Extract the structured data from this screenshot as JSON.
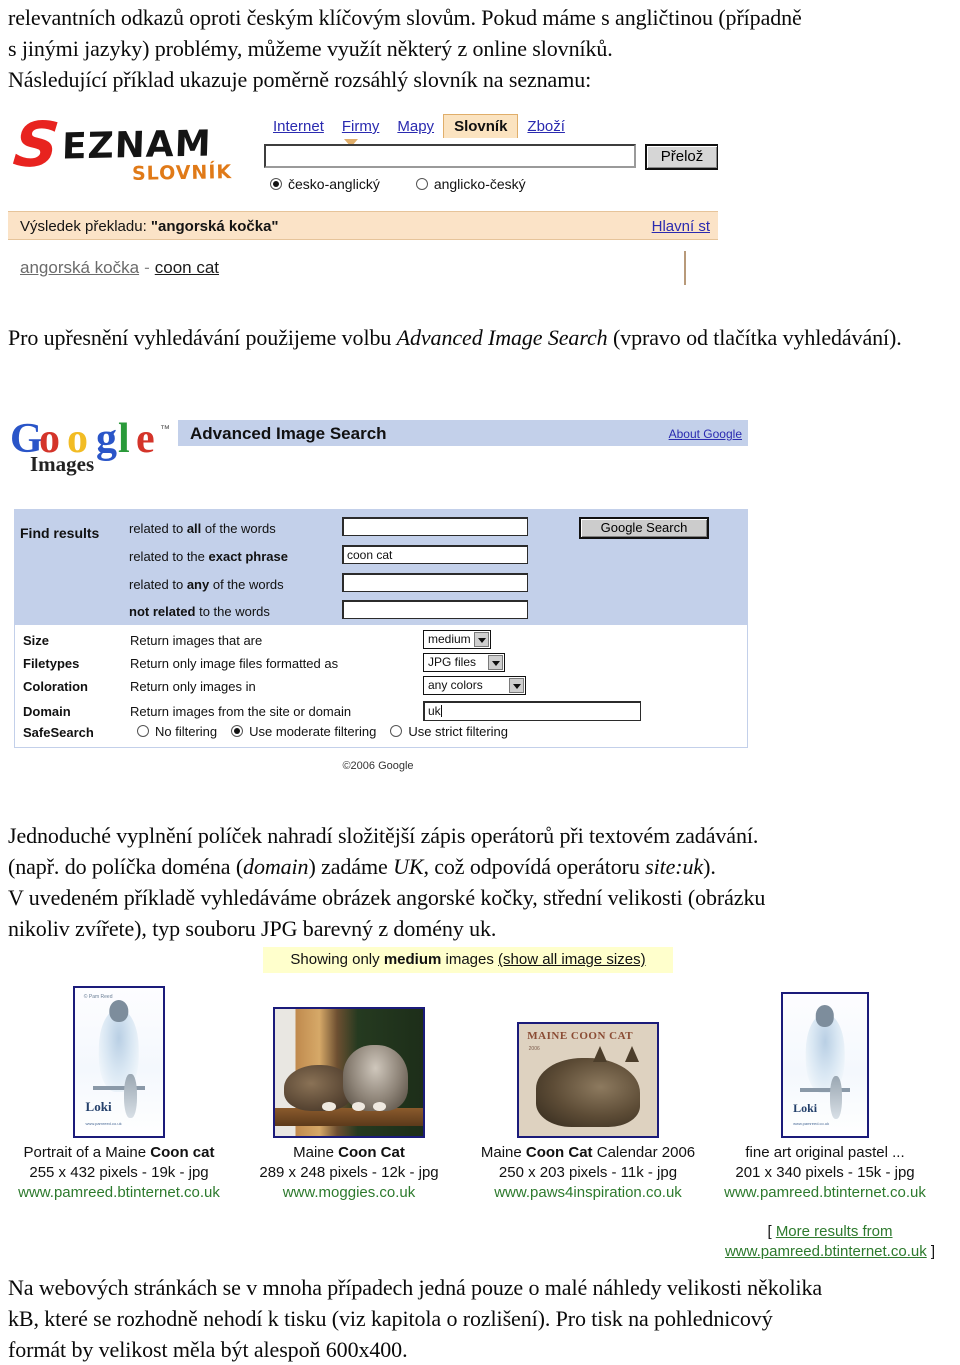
{
  "document": {
    "para_intro": [
      "relevantních odkazů oproti českým klíčovým slovům. Pokud máme s angličtinou (případně",
      "s jinými jazyky) problémy, můžeme využít některý z online slovníků.",
      "Následující příklad ukazuje poměrně rozsáhlý slovník na seznamu:"
    ],
    "para_advanced_prefix": "Pro upřesnění vyhledávání použijeme volbu ",
    "para_advanced_italic": "Advanced Image Search",
    "para_advanced_suffix": " (vpravo od tlačítka vyhledávání).",
    "para_simple": {
      "line1": "Jednoduché vyplnění políček nahradí složitější zápis operátorů při textovém zadávání.",
      "line2_a": "(např. do políčka doména (",
      "line2_i1": "domain",
      "line2_b": ") zadáme ",
      "line2_i2": "UK",
      "line2_c": ", což odpovídá operátoru ",
      "line2_i3": "site:uk",
      "line2_d": ").",
      "line3": "V uvedeném příkladě vyhledáváme obrázek angorské kočky, střední velikosti (obrázku",
      "line4": "nikoliv zvířete), typ souboru JPG barevný z domény uk."
    },
    "para_final": [
      "Na webových stránkách se v mnoha případech jedná pouze o malé náhledy velikosti několika",
      "kB, které se rozhodně nehodí k tisku (viz kapitola o rozlišení). Pro tisk na pohlednicový",
      "formát by velikost měla být alespoň 600x400."
    ]
  },
  "seznam": {
    "logo": {
      "s": "S",
      "rest": "EZNAM",
      "subtitle": "SLOVNÍK",
      "color_s": "#e8231f",
      "color_rest": "#141414",
      "color_subtitle": "#e07a18"
    },
    "tabs": [
      {
        "label": "Internet",
        "active": false
      },
      {
        "label": "Firmy",
        "active": false
      },
      {
        "label": "Mapy",
        "active": false
      },
      {
        "label": "Slovník",
        "active": true
      },
      {
        "label": "Zboží",
        "active": false
      }
    ],
    "query_value": "",
    "translate_button": "Přelož",
    "direction_options": [
      {
        "label": "česko-anglický",
        "selected": true
      },
      {
        "label": "anglicko-český",
        "selected": false
      }
    ],
    "result_bar": {
      "prefix": "Výsledek překladu: ",
      "term": "\"angorská kočka\"",
      "right_link": "Hlavní st",
      "background": "#fbe3c7"
    },
    "entry": {
      "czech": "angorská kočka",
      "dash": "-",
      "english": "coon cat"
    }
  },
  "google_advanced": {
    "logo": {
      "letters": [
        "G",
        "o",
        "o",
        "g",
        "l",
        "e"
      ],
      "trademark": "™",
      "sub": "Images",
      "colors": [
        "#2a55c8",
        "#d4342a",
        "#f2bc24",
        "#2a55c8",
        "#2a9a3a",
        "#d4342a"
      ]
    },
    "title": "Advanced Image Search",
    "about_link": "About Google",
    "find_results_label": "Find results",
    "search_button": "Google Search",
    "find_rows": [
      {
        "label_a": "related to ",
        "label_b": "all",
        "label_c": " of the words",
        "value": ""
      },
      {
        "label_a": "related to the ",
        "label_b": "exact phrase",
        "label_c": "",
        "value": "coon cat"
      },
      {
        "label_a": "related to ",
        "label_b": "any",
        "label_c": " of the words",
        "value": ""
      },
      {
        "label_a": "",
        "label_b": "not related",
        "label_c": " to the words",
        "value": ""
      }
    ],
    "options": [
      {
        "name": "Size",
        "desc": "Return images that are",
        "value": "medium"
      },
      {
        "name": "Filetypes",
        "desc": "Return only image files formatted as",
        "value": "JPG files"
      },
      {
        "name": "Coloration",
        "desc": "Return only images in",
        "value": "any colors"
      },
      {
        "name": "Domain",
        "desc": "Return images from the site or domain",
        "value": "uk"
      }
    ],
    "safesearch_label": "SafeSearch",
    "safesearch_options": [
      {
        "label": "No filtering",
        "selected": false
      },
      {
        "label": "Use moderate filtering",
        "selected": true
      },
      {
        "label": "Use strict filtering",
        "selected": false
      }
    ],
    "copyright": "©2006 Google",
    "panel_color": "#c3d0ea"
  },
  "results": {
    "banner": {
      "prefix": "Showing only ",
      "bold": "medium",
      "suffix": " images ",
      "link": "(show all image sizes)",
      "background": "#ffffcc"
    },
    "items": [
      {
        "title_a": "Portrait of a Maine ",
        "title_b": "Coon cat",
        "title_c": "",
        "dims": "255 x 432 pixels - 19k - jpg",
        "url": "www.pamreed.btinternet.co.uk",
        "thumb_w": 88,
        "thumb_h": 148,
        "art": "loki",
        "art_text": {
          "name": "Loki",
          "sub": "www.pamreed.co.uk",
          "credit": "© Pam Reed"
        }
      },
      {
        "title_a": "Maine ",
        "title_b": "Coon Cat",
        "title_c": "",
        "dims": "289 x 248 pixels - 12k - jpg",
        "url": "www.moggies.co.uk",
        "thumb_w": 148,
        "thumb_h": 127,
        "art": "window",
        "art_text": {}
      },
      {
        "title_a": "Maine ",
        "title_b": "Coon Cat",
        "title_c": " Calendar 2006",
        "dims": "250 x 203 pixels - 11k - jpg",
        "url": "www.paws4inspiration.co.uk",
        "thumb_w": 138,
        "thumb_h": 112,
        "art": "calendar",
        "art_text": {
          "title": "MAINE COON CAT",
          "sub": "2006"
        }
      },
      {
        "title_a": "fine art original pastel ...",
        "title_b": "",
        "title_c": "",
        "dims": "201 x 340 pixels - 15k - jpg",
        "url": "www.pamreed.btinternet.co.uk",
        "thumb_w": 84,
        "thumb_h": 142,
        "art": "loki",
        "art_text": {
          "name": "Loki",
          "sub": "www.pamreed.co.uk",
          "credit": ""
        }
      }
    ],
    "more_results": {
      "open_bracket": "[ ",
      "link_line1": "More results from",
      "link_line2": "www.pamreed.btinternet.co.uk",
      "close_bracket": " ]"
    }
  }
}
